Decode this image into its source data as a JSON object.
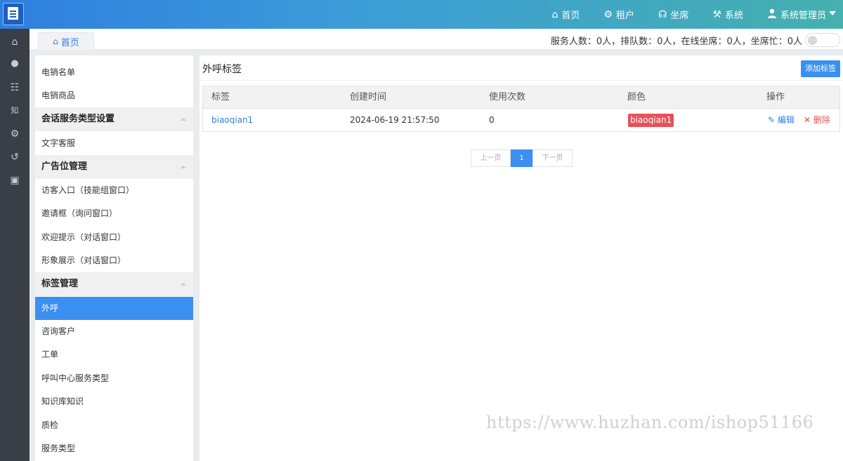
{
  "topnav": {
    "items": [
      {
        "icon": "home-icon",
        "glyph": "⌂",
        "label": "首页"
      },
      {
        "icon": "gear-icon",
        "glyph": "⚙",
        "label": "租户"
      },
      {
        "icon": "headset-icon",
        "glyph": "☊",
        "label": "坐席"
      },
      {
        "icon": "tools-icon",
        "glyph": "⚒",
        "label": "系统"
      }
    ],
    "user_label": "系统管理员"
  },
  "tabs": [
    {
      "label": "首页"
    }
  ],
  "status": {
    "text": "服务人数：0人，排队数：0人，在线坐席：0人，坐席忙：0人",
    "busy_toggle": false
  },
  "rail_icons": [
    "home-icon",
    "user-icon",
    "user-list-icon",
    "knowledge-icon",
    "gear-icon",
    "history-icon",
    "monitor-icon"
  ],
  "rail_glyphs": [
    "⌂",
    "●",
    "☷",
    "知",
    "⚙",
    "↺",
    "▣"
  ],
  "menu": {
    "items": [
      {
        "type": "item",
        "label": "电销名单"
      },
      {
        "type": "item",
        "label": "电销商品"
      },
      {
        "type": "group",
        "label": "会话服务类型设置"
      },
      {
        "type": "item",
        "label": "文字客服"
      },
      {
        "type": "group",
        "label": "广告位管理"
      },
      {
        "type": "item",
        "label": "访客入口（技能组窗口）"
      },
      {
        "type": "item",
        "label": "邀请框（询问窗口）"
      },
      {
        "type": "item",
        "label": "欢迎提示（对话窗口）"
      },
      {
        "type": "item",
        "label": "形象展示（对话窗口）"
      },
      {
        "type": "group",
        "label": "标签管理"
      },
      {
        "type": "item",
        "label": "外呼",
        "active": true
      },
      {
        "type": "item",
        "label": "咨询客户"
      },
      {
        "type": "item",
        "label": "工单"
      },
      {
        "type": "item",
        "label": "呼叫中心服务类型"
      },
      {
        "type": "item",
        "label": "知识库知识"
      },
      {
        "type": "item",
        "label": "质检"
      },
      {
        "type": "item",
        "label": "服务类型"
      }
    ]
  },
  "content": {
    "title": "外呼标签",
    "add_button": "添加标签",
    "table": {
      "headers": [
        "标签",
        "创建时间",
        "使用次数",
        "颜色",
        "操作"
      ],
      "rows": [
        {
          "name": "biaoqian1",
          "created": "2024-06-19 21:57:50",
          "count": "0",
          "color_label": "biaoqian1",
          "color": "#e8515a",
          "edit": "编辑",
          "delete": "删除"
        }
      ]
    },
    "pager": {
      "prev": "上一页",
      "current": "1",
      "next": "下一页"
    }
  },
  "watermark": "https://www.huzhan.com/ishop51166"
}
